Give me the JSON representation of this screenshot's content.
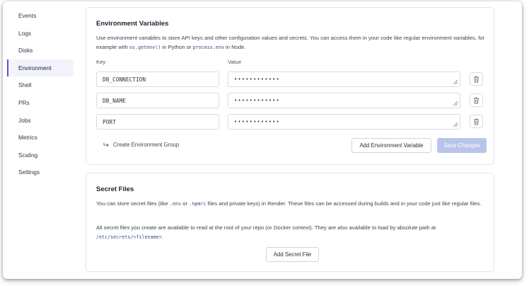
{
  "sidebar": {
    "items": [
      {
        "label": "Events"
      },
      {
        "label": "Logs"
      },
      {
        "label": "Disks"
      },
      {
        "label": "Environment",
        "active": true
      },
      {
        "label": "Shell"
      },
      {
        "label": "PRs"
      },
      {
        "label": "Jobs"
      },
      {
        "label": "Metrics"
      },
      {
        "label": "Scaling"
      },
      {
        "label": "Settings"
      }
    ]
  },
  "env": {
    "title": "Environment Variables",
    "desc_1": "Use environment variables to store API keys and other configuration values and secrets. You can access them in your code like regular environment variables, for example with ",
    "code_1": "os.getenv()",
    "desc_2": " in Python or ",
    "code_2": "process.env",
    "desc_3": " in Node.",
    "key_label": "Key",
    "value_label": "Value",
    "vars": [
      {
        "key": "DB_CONNECTION",
        "value": "••••••••••••"
      },
      {
        "key": "DB_NAME",
        "value": "••••••••••••"
      },
      {
        "key": "PORT",
        "value": "••••••••••••"
      }
    ],
    "create_group_label": "Create Environment Group",
    "add_button": "Add Environment Variable",
    "save_button": "Save Changes"
  },
  "secret": {
    "title": "Secret Files",
    "p1_a": "You can store secret files (like ",
    "p1_code1": ".env",
    "p1_b": " or ",
    "p1_code2": ".npmrc",
    "p1_c": " files and private keys) in Render. These files can be accessed during builds and in your code just like regular files.",
    "p2_a": "All secret files you create are available to read at the root of your repo (or Docker context). They are also available to load by absolute path at ",
    "p2_code": "/etc/secrets/<filename>",
    "p2_b": ".",
    "add_button": "Add Secret File"
  },
  "colors": {
    "accent": "#5b4fd6",
    "save_disabled": "#b9c5e8",
    "border": "#d7dbe0"
  }
}
